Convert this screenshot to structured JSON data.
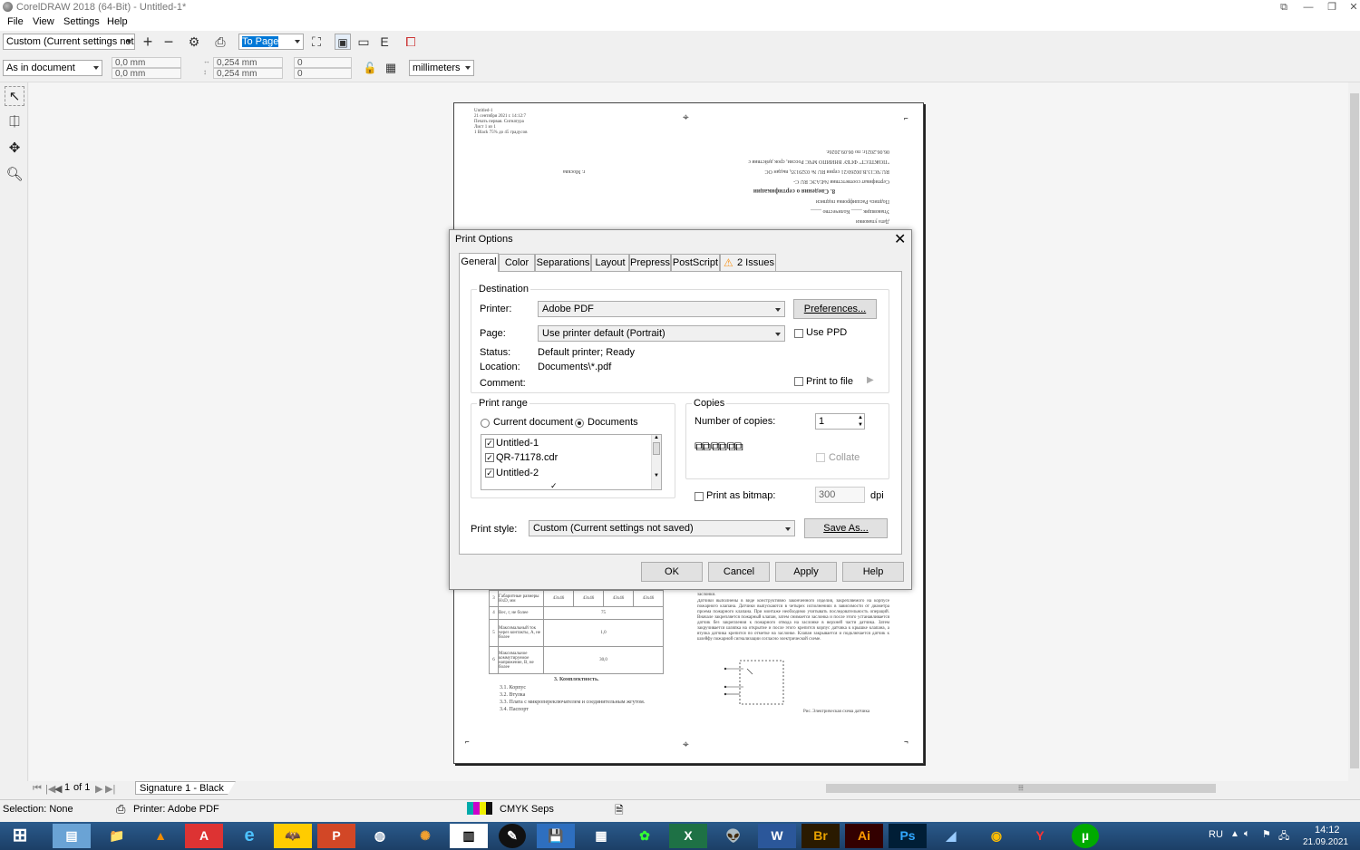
{
  "window": {
    "title": "CorelDRAW 2018 (64-Bit) - Untitled-1*"
  },
  "menu": [
    "File",
    "View",
    "Settings",
    "Help"
  ],
  "toolbar": {
    "style_combo": "Custom (Current settings not ...",
    "fit_combo": "To Page",
    "position_combo": "As in document",
    "x_pos": "0,0 mm",
    "y_pos": "0,0 mm",
    "width": "0,254 mm",
    "height": "0,254 mm",
    "scale_x": "0",
    "scale_y": "0",
    "units": "millimeters"
  },
  "document": {
    "header_lines": [
      "Untitled-1",
      "21 сентября 2021 г. 14:12:7",
      "Печать первая. Сигнатура",
      "Лист 1 из 1",
      "1 Black 75% до 45 градусов"
    ],
    "city": "г. Москва",
    "section_title": "8. Сведения о сертификации",
    "cert_lines": [
      "Сертификат соответствия №ЕАЭС RU C-",
      "RU.ЧС13.В.00260/21 серия RU № 0329135, выдан ОС",
      "\"ПОЖТЕСТ\" ФГБУ ВНИИПО МЧС России, срок действия с",
      "06.06.2021г. по 06.09.2026г."
    ],
    "sign_lines": [
      "Дата упаковки",
      "Упаковщик",
      "Количество",
      "Подпись",
      "Расшифровка подписи"
    ],
    "table_rows": [
      {
        "n": "3",
        "name": "Габаритные размеры HxD, мм",
        "vals": [
          "43x46",
          "43x46",
          "43x46",
          "43x46"
        ]
      },
      {
        "n": "4",
        "name": "Вес, г, не более",
        "vals": [
          "75"
        ]
      },
      {
        "n": "5",
        "name": "Максимальный ток через контакты, А, не более",
        "vals": [
          "1,0"
        ]
      },
      {
        "n": "6",
        "name": "Максимальное коммутируемое напряжение, В, не более",
        "vals": [
          "30,0"
        ]
      }
    ],
    "section3_title": "3. Комплектность.",
    "kit": [
      "3.1.  Корпус",
      "3.2.  Втулка",
      "3.3.  Плата с микропереключателем и соединительным жгутом.",
      "3.4.  Паспорт"
    ],
    "right_text": "Датчики выполнены в виде конструктивно законченного изделия, закрепляемого на корпусе пожарного клапана. Датчики выпускаются в четырех исполнениях в зависимости от диаметра проема пожарного клапана. При монтаже необходимо учитывать последовательность операций. Вначале закрепляется пожарный клапан, затем снимается заслонка и после этого устанавливается датчик без закрепления к пожарного отвода на заслонке в верхней части датчика. Затем закручивается шляпка на открытие и после этого крепится корпус датчика к крышке клапана, а втулка датчика крепится по отметке на заслонке. Клапан закрывается и подключается датчик к шлейфу пожарной сигнализации согласно электрической схеме.",
    "right_top": "заслонки.",
    "diagram_caption": "Рис. Электрическая схема датчика"
  },
  "page_nav": {
    "page": "1",
    "of": "of 1",
    "tab": "Signature 1 - Black"
  },
  "dialog": {
    "title": "Print Options",
    "tabs": [
      "General",
      "Color",
      "Separations",
      "Layout",
      "Prepress",
      "PostScript",
      "2 Issues"
    ],
    "destination_title": "Destination",
    "printer_label": "Printer:",
    "printer_value": "Adobe PDF",
    "preferences_btn": "Preferences...",
    "page_label": "Page:",
    "page_value": "Use printer default (Portrait)",
    "use_ppd": "Use PPD",
    "status_label": "Status:",
    "status_value": "Default printer; Ready",
    "location_label": "Location:",
    "location_value": "Documents\\*.pdf",
    "comment_label": "Comment:",
    "print_to_file": "Print to file",
    "print_range_title": "Print range",
    "current_document": "Current document",
    "documents": "Documents",
    "doc_list": [
      "Untitled-1",
      "QR-71178.cdr",
      "Untitled-2"
    ],
    "copies_title": "Copies",
    "num_copies_label": "Number of copies:",
    "num_copies": "1",
    "collate": "Collate",
    "print_as_bitmap": "Print as bitmap:",
    "dpi_value": "300",
    "dpi_unit": "dpi",
    "print_style_label": "Print style:",
    "print_style_value": "Custom (Current settings not saved)",
    "save_as_btn": "Save As...",
    "ok": "OK",
    "cancel": "Cancel",
    "apply": "Apply",
    "help": "Help"
  },
  "statusbar": {
    "selection": "Selection: None",
    "printer": "Printer: Adobe PDF",
    "seps": "CMYK Seps"
  },
  "taskbar": {
    "lang": "RU",
    "time": "14:12",
    "date": "21.09.2021",
    "apps": [
      "W",
      "Br",
      "Ai",
      "Ps"
    ]
  },
  "colors": {
    "taskbar": "#1c3f66",
    "warning": "#f7941d",
    "selected_combo": "#0078d7"
  }
}
